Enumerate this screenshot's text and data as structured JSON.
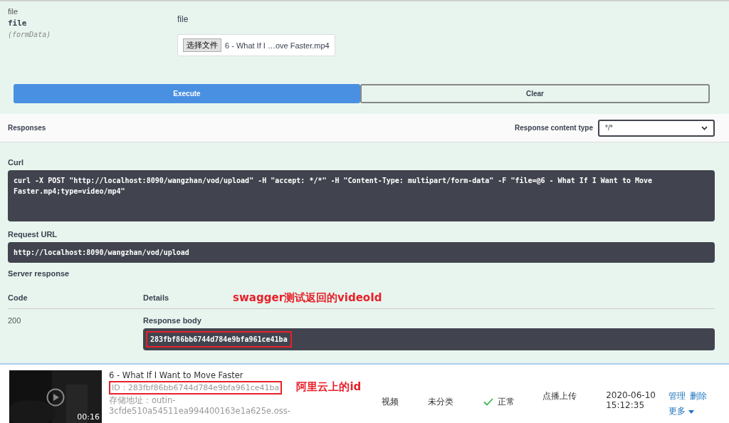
{
  "parameter": {
    "name": "file",
    "type": "file",
    "location": "(formData)",
    "description": "file",
    "choose_button": "选择文件",
    "file_name": "6 - What If I …ove Faster.mp4"
  },
  "buttons": [
    {
      "label": "Execute",
      "kind": "primary"
    },
    {
      "label": "Clear",
      "kind": "secondary"
    }
  ],
  "responses": {
    "title": "Responses",
    "content_type_label": "Response content type",
    "content_type": "*/*"
  },
  "curl": {
    "label": "Curl",
    "command": "curl -X POST \"http://localhost:8090/wangzhan/vod/upload\" -H \"accept: */*\" -H \"Content-Type: multipart/form-data\" -F \"file=@6 - What If I Want to Move Faster.mp4;type=video/mp4\""
  },
  "request_url": {
    "label": "Request URL",
    "url": "http://localhost:8090/wangzhan/vod/upload"
  },
  "server_response": {
    "title": "Server response",
    "columns": [
      "Code",
      "Details"
    ],
    "annotation": "swagger测试返回的videoId",
    "code": "200",
    "body_label": "Response body",
    "body": "283fbf86bb6744d784e9bfa961ce41ba",
    "highlighted": true
  },
  "video_row": {
    "title": "6 - What If I Want to Move Faster",
    "id": "ID：283fbf86bb6744d784e9bfa961ce41ba",
    "highlighted": true,
    "annotation": "阿里云上的id",
    "storage": "存储地址：outin-3cfde510a54511ea994400163e1a625e.oss-",
    "duration": "00:16",
    "type": "视频",
    "category": "未分类",
    "status": "正常",
    "source": "点播上传",
    "date": "2020-06-10",
    "time": "15:12:35",
    "actions": [
      "管理",
      "删除",
      "更多"
    ]
  }
}
